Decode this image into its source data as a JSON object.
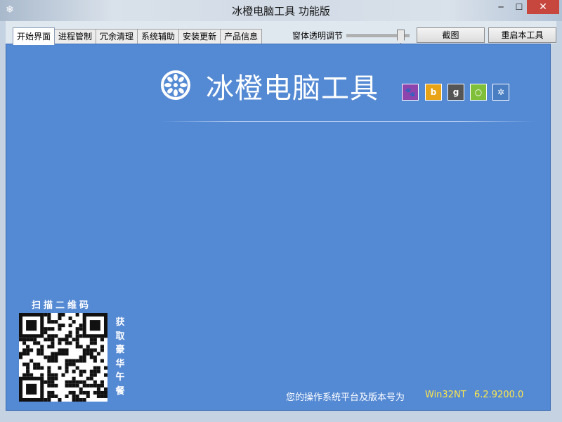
{
  "window": {
    "title": "冰橙电脑工具 功能版",
    "minimize_glyph": "─",
    "maximize_glyph": "☐",
    "close_glyph": "✕"
  },
  "tabs": [
    {
      "label": "开始界面",
      "active": true
    },
    {
      "label": "进程管制",
      "active": false
    },
    {
      "label": "冗余清理",
      "active": false
    },
    {
      "label": "系统辅助",
      "active": false
    },
    {
      "label": "安装更新",
      "active": false
    },
    {
      "label": "产品信息",
      "active": false
    }
  ],
  "toolbar": {
    "opacity_label": "窗体透明调节",
    "opacity_value": 0.9,
    "screenshot_label": "截图",
    "restart_label": "重启本工具"
  },
  "main": {
    "app_name": "冰橙电脑工具",
    "social_icons": [
      "baidu-paw-icon",
      "bing-icon",
      "google-icon",
      "chat-bubble-icon",
      "settings-gear-icon"
    ],
    "qr_title": "扫描二维码",
    "qr_caption": "获取豪华午餐",
    "status_label": "您的操作系统平台及版本号为",
    "os_name": "Win32NT",
    "os_version": "6.2.9200.0"
  },
  "colors": {
    "panel_bg": "#5489d4",
    "highlight_text": "#ffe84a",
    "close_button": "#c7463d"
  }
}
